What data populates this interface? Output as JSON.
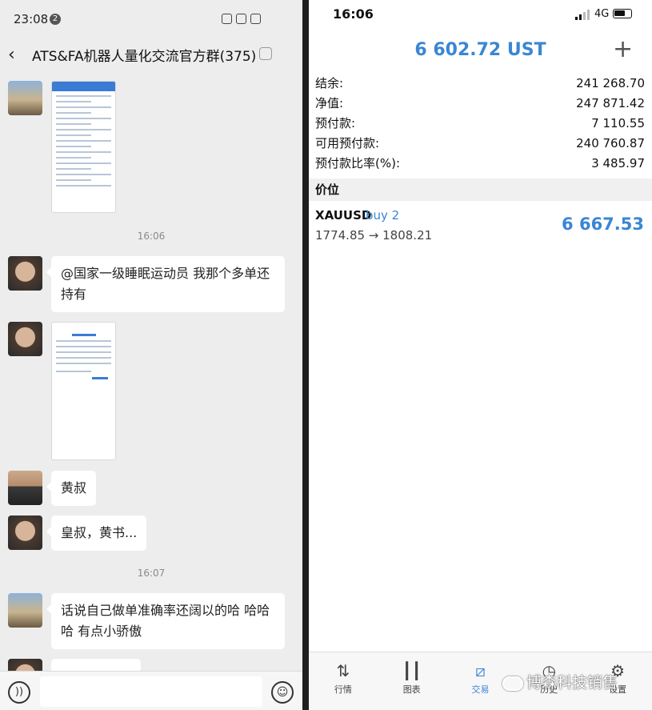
{
  "chat": {
    "status_time": "23:08",
    "notification_count": "2",
    "title": "ATS&FA机器人量化交流官方群(375)",
    "timestamps": [
      "16:06",
      "16:07"
    ],
    "messages": {
      "m1": "@国家一级睡眠运动员  我那个多单还持有",
      "m2": "黄叔",
      "m3": "皇叔，黄书...",
      "m4": "话说自己做单准确率还阔以的哈 哈哈哈 有点小骄傲"
    },
    "icons": [
      "back-arrow-icon",
      "mute-bell-icon",
      "voice-icon",
      "emoji-icon"
    ]
  },
  "trade": {
    "status_time": "16:06",
    "network": "4G",
    "balance_header": "6 602.72 UST",
    "summary": [
      {
        "label": "结余:",
        "value": "241 268.70"
      },
      {
        "label": "净值:",
        "value": "247 871.42"
      },
      {
        "label": "预付款:",
        "value": "7 110.55"
      },
      {
        "label": "可用预付款:",
        "value": "240 760.87"
      },
      {
        "label": "预付款比率(%):",
        "value": "3 485.97"
      }
    ],
    "section_title": "价位",
    "position": {
      "symbol": "XAUUSD",
      "side": "buy 2",
      "prices": "1774.85 → 1808.21",
      "profit": "6 667.53"
    },
    "tabs": [
      {
        "label": "行情",
        "icon": "quotes-arrows-icon",
        "active": false
      },
      {
        "label": "图表",
        "icon": "candlestick-chart-icon",
        "active": false
      },
      {
        "label": "交易",
        "icon": "trade-chart-icon",
        "active": true
      },
      {
        "label": "历史",
        "icon": "history-clock-icon",
        "active": false
      },
      {
        "label": "设置",
        "icon": "settings-gear-icon",
        "active": false
      }
    ],
    "accent_color": "#3a86d4"
  },
  "watermark": "博森科技销售"
}
